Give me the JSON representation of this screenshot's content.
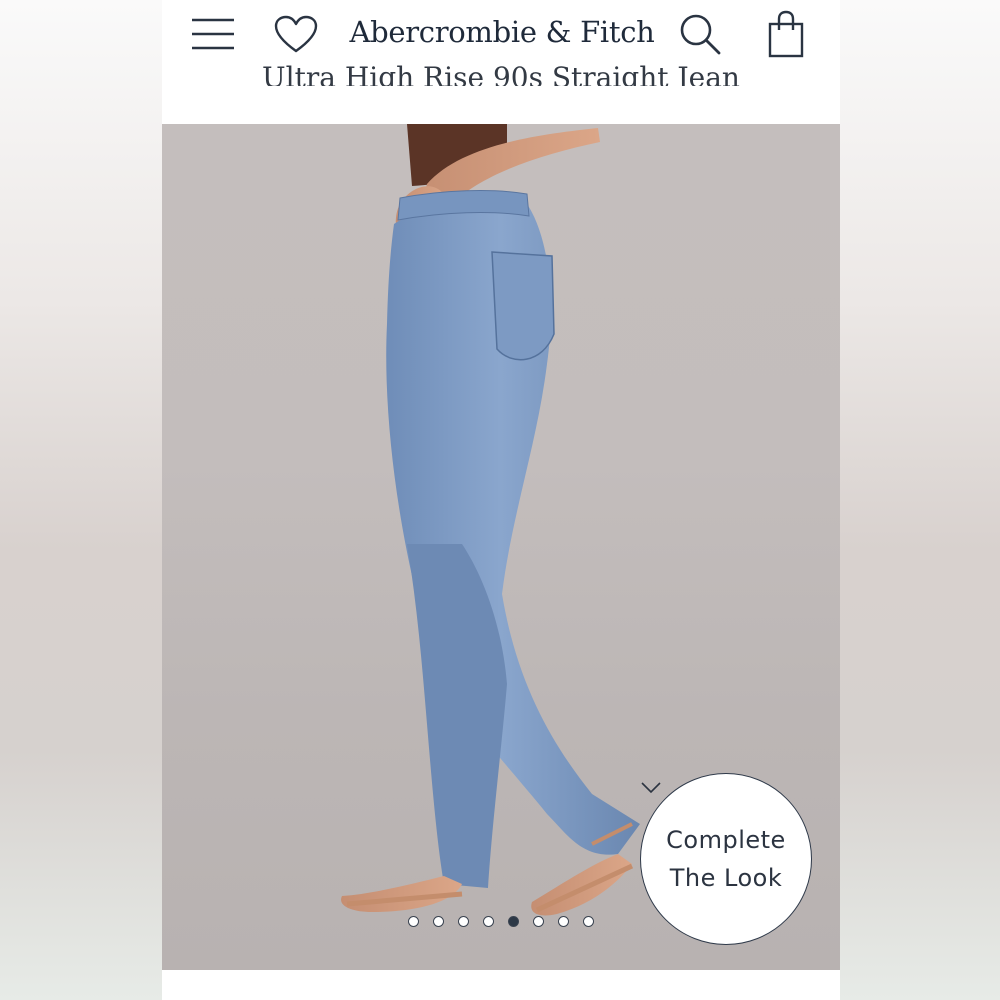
{
  "header": {
    "brand": "Abercrombie & Fitch",
    "product_title": "Ultra High Rise 90s Straight Jean",
    "icons": {
      "menu": "hamburger-menu-icon",
      "wishlist": "heart-icon",
      "search": "search-icon",
      "bag": "shopping-bag-icon"
    }
  },
  "gallery": {
    "image_count": 8,
    "active_index": 4,
    "complete_look": {
      "line1": "Complete",
      "line2": "The Look",
      "icon": "chevron-down-icon"
    }
  },
  "colors": {
    "brand_text": "#1f2a3a",
    "accent": "#2d3846",
    "photo_background": "#c3bdbc",
    "denim": "#7f9cc4"
  }
}
